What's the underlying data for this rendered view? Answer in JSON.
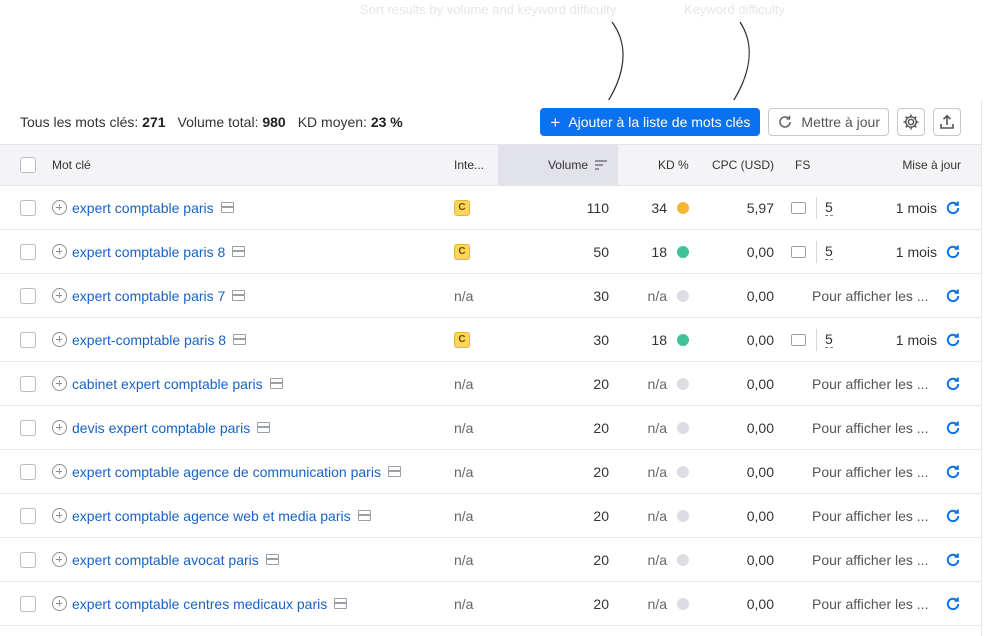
{
  "annotation": {
    "ghost_left": "Sort results by volume and keyword difficulty",
    "ghost_right": "Keyword difficulty"
  },
  "toolbar": {
    "stats": [
      {
        "label": "Tous les mots clés:",
        "value": "271"
      },
      {
        "label": "Volume total:",
        "value": "980"
      },
      {
        "label": "KD moyen:",
        "value": "23 %"
      }
    ],
    "add_button": "Ajouter à la liste de mots clés",
    "update_button": "Mettre à jour",
    "settings_icon": "gear-icon",
    "export_icon": "upload-icon"
  },
  "table": {
    "headers": {
      "keyword": "Mot clé",
      "intent": "Inte...",
      "volume": "Volume",
      "kd": "KD %",
      "cpc": "CPC (USD)",
      "fs": "FS",
      "update": "Mise à jour"
    },
    "rows": [
      {
        "keyword": "expert comptable paris",
        "intent": "C",
        "volume": "110",
        "kd": "34",
        "kd_color": "#f5b733",
        "cpc": "5,97",
        "fs": "5",
        "update": "1 mois"
      },
      {
        "keyword": "expert comptable paris 8",
        "intent": "C",
        "volume": "50",
        "kd": "18",
        "kd_color": "#3dc29a",
        "cpc": "0,00",
        "fs": "5",
        "update": "1 mois"
      },
      {
        "keyword": "expert comptable paris 7",
        "intent": "n/a",
        "volume": "30",
        "kd": "n/a",
        "kd_color": "#dcdce4",
        "cpc": "0,00",
        "fs": "",
        "update": "Pour afficher les ..."
      },
      {
        "keyword": "expert-comptable paris 8",
        "intent": "C",
        "volume": "30",
        "kd": "18",
        "kd_color": "#3dc29a",
        "cpc": "0,00",
        "fs": "5",
        "update": "1 mois"
      },
      {
        "keyword": "cabinet expert comptable paris",
        "intent": "n/a",
        "volume": "20",
        "kd": "n/a",
        "kd_color": "#dcdce4",
        "cpc": "0,00",
        "fs": "",
        "update": "Pour afficher les ..."
      },
      {
        "keyword": "devis expert comptable paris",
        "intent": "n/a",
        "volume": "20",
        "kd": "n/a",
        "kd_color": "#dcdce4",
        "cpc": "0,00",
        "fs": "",
        "update": "Pour afficher les ..."
      },
      {
        "keyword": "expert comptable agence de communication paris",
        "intent": "n/a",
        "volume": "20",
        "kd": "n/a",
        "kd_color": "#dcdce4",
        "cpc": "0,00",
        "fs": "",
        "update": "Pour afficher les ..."
      },
      {
        "keyword": "expert comptable agence web et media paris",
        "intent": "n/a",
        "volume": "20",
        "kd": "n/a",
        "kd_color": "#dcdce4",
        "cpc": "0,00",
        "fs": "",
        "update": "Pour afficher les ..."
      },
      {
        "keyword": "expert comptable avocat paris",
        "intent": "n/a",
        "volume": "20",
        "kd": "n/a",
        "kd_color": "#dcdce4",
        "cpc": "0,00",
        "fs": "",
        "update": "Pour afficher les ..."
      },
      {
        "keyword": "expert comptable centres medicaux paris",
        "intent": "n/a",
        "volume": "20",
        "kd": "n/a",
        "kd_color": "#dcdce4",
        "cpc": "0,00",
        "fs": "",
        "update": "Pour afficher les ..."
      }
    ]
  },
  "colors": {
    "accent": "#0a72ef",
    "link": "#1762c6"
  }
}
